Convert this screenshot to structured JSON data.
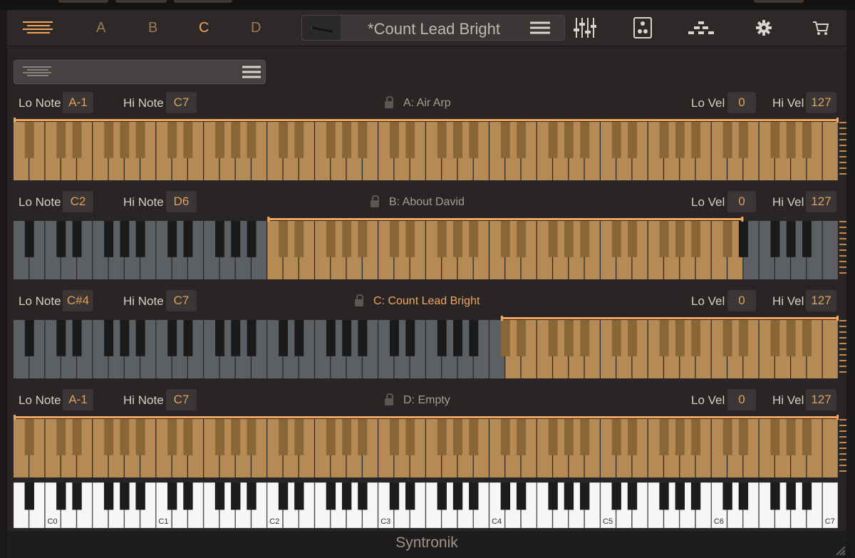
{
  "toolbar": {
    "parts": [
      {
        "label": "A",
        "active": false
      },
      {
        "label": "B",
        "active": false
      },
      {
        "label": "C",
        "active": true
      },
      {
        "label": "D",
        "active": false
      }
    ],
    "preset_name": "*Count Lead Bright"
  },
  "labels": {
    "lo_note": "Lo Note",
    "hi_note": "Hi Note",
    "lo_vel": "Lo Vel",
    "hi_vel": "Hi Vel"
  },
  "zones": [
    {
      "name": "A: Air Arp",
      "lo_note": "A-1",
      "hi_note": "C7",
      "lo_vel": "0",
      "hi_vel": "127",
      "active": false
    },
    {
      "name": "B: About David",
      "lo_note": "C2",
      "hi_note": "D6",
      "lo_vel": "0",
      "hi_vel": "127",
      "active": false
    },
    {
      "name": "C: Count Lead Bright",
      "lo_note": "C#4",
      "hi_note": "C7",
      "lo_vel": "0",
      "hi_vel": "127",
      "active": true
    },
    {
      "name": "D: Empty",
      "lo_note": "A-1",
      "hi_note": "C7",
      "lo_vel": "0",
      "hi_vel": "127",
      "active": false
    }
  ],
  "keyboard": {
    "octave_labels": [
      "C0",
      "C1",
      "C2",
      "C3",
      "C4",
      "C5",
      "C6",
      "C7"
    ]
  },
  "footer": {
    "brand": "Syntronik"
  },
  "colors": {
    "accent": "#f2a55c",
    "zone_key": "#b58a55",
    "zone_black": "#8a6637",
    "inactive_key": "#5d6062",
    "inactive_black": "#1a1a1a"
  }
}
